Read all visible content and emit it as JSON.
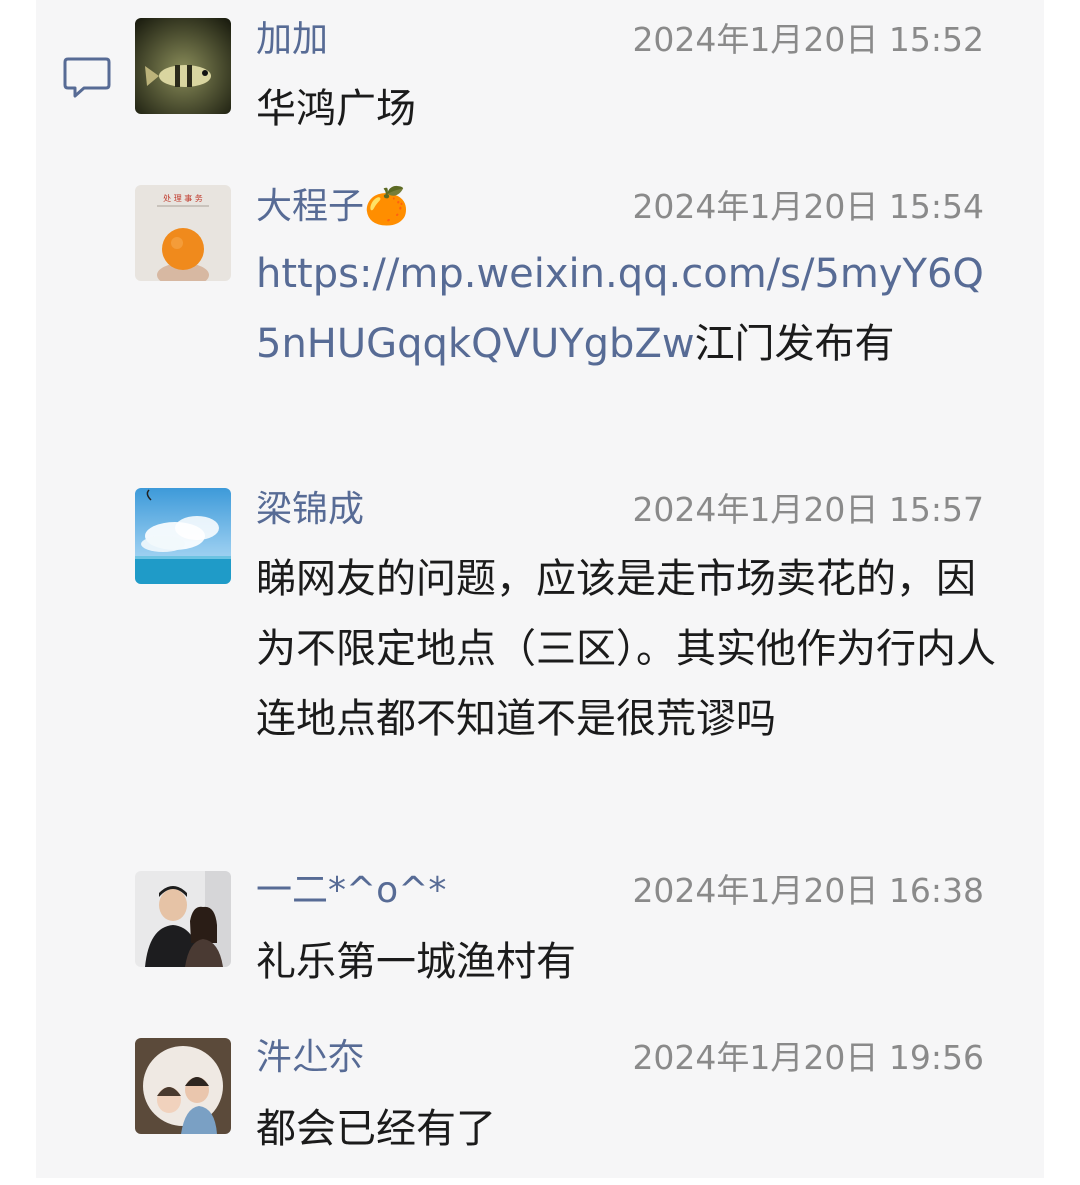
{
  "colors": {
    "link": "#576b95",
    "time": "#8a8a8a",
    "text": "#1b1b1b",
    "panel": "#f6f6f7"
  },
  "icons": {
    "comment": "comment-icon"
  },
  "messages": [
    {
      "name": "加加",
      "time": "2024年1月20日 15:52",
      "text": "华鸿广场",
      "avatar": "fish-avatar"
    },
    {
      "name": "大程子",
      "emoji": "🍊",
      "time": "2024年1月20日 15:54",
      "link": "https://mp.weixin.qq.com/s/5myY6Q5nHUGqqkQVUYgbZw",
      "text": "江门发布有",
      "avatar": "orange-avatar",
      "avatar_caption": "处 理 事 务"
    },
    {
      "name": "梁锦成",
      "time": "2024年1月20日 15:57",
      "text": "睇网友的问题，应该是走市场卖花的，因为不限定地点（三区）。其实他作为行内人连地点都不知道不是很荒谬吗",
      "avatar": "sky-sea-avatar"
    },
    {
      "name": "一二*^o^*",
      "time": "2024年1月20日 16:38",
      "text": "礼乐第一城渔村有",
      "avatar": "couple-avatar"
    },
    {
      "name": "汼尐夵",
      "time": "2024年1月20日 19:56",
      "text": "都会已经有了",
      "avatar": "kids-avatar"
    }
  ]
}
